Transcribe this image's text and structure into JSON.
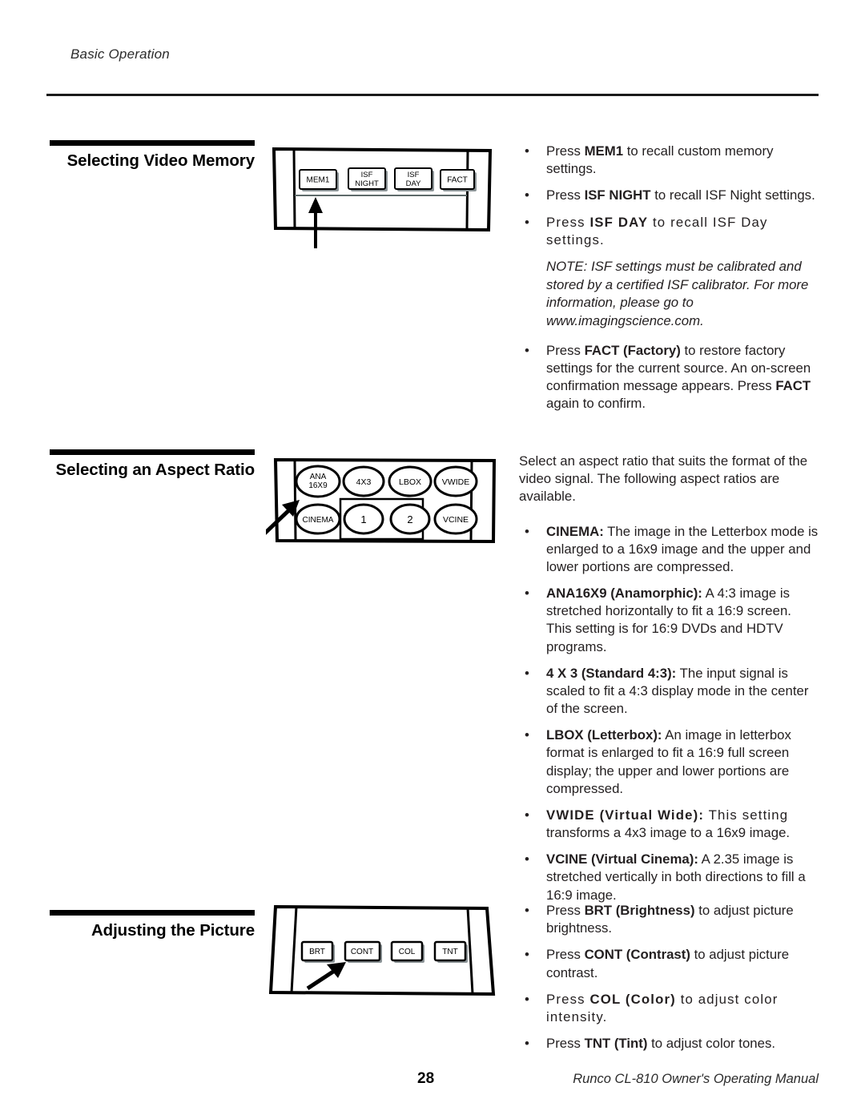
{
  "header": {
    "running_head": "Basic Operation"
  },
  "sections": [
    {
      "id": "video-memory",
      "heading": "Selecting Video Memory",
      "remote": {
        "name": "video-memory-remote",
        "style": "rect-buttons",
        "buttons": [
          {
            "label_lines": [
              "MEM1"
            ]
          },
          {
            "label_lines": [
              "ISF",
              "NIGHT"
            ]
          },
          {
            "label_lines": [
              "ISF",
              "DAY"
            ]
          },
          {
            "label_lines": [
              "FACT"
            ]
          }
        ],
        "callout": "vertical-arrow-up"
      }
    },
    {
      "id": "aspect-ratio",
      "heading": "Selecting an Aspect Ratio",
      "remote": {
        "name": "aspect-ratio-remote",
        "style": "oval-buttons",
        "row1": [
          {
            "label_lines": [
              "ANA",
              "16X9"
            ]
          },
          {
            "label_lines": [
              "4X3"
            ]
          },
          {
            "label_lines": [
              "LBOX"
            ]
          },
          {
            "label_lines": [
              "VWIDE"
            ]
          }
        ],
        "row2": [
          {
            "label_lines": [
              "CINEMA"
            ]
          },
          {
            "label_lines": [
              "1"
            ]
          },
          {
            "label_lines": [
              "2"
            ]
          },
          {
            "label_lines": [
              "VCINE"
            ]
          }
        ],
        "callout": "diagonal-arrow-up-right"
      }
    },
    {
      "id": "adjusting-picture",
      "heading": "Adjusting the Picture",
      "remote": {
        "name": "picture-adjust-remote",
        "style": "rect-buttons",
        "buttons": [
          {
            "label_lines": [
              "BRT"
            ]
          },
          {
            "label_lines": [
              "CONT"
            ]
          },
          {
            "label_lines": [
              "COL"
            ]
          },
          {
            "label_lines": [
              "TNT"
            ]
          }
        ],
        "callout": "diagonal-arrow-up-right"
      }
    }
  ],
  "body": {
    "video_memory": {
      "bullets": [
        {
          "prefix": "Press ",
          "bold": "MEM1",
          "rest": " to recall custom memory settings."
        },
        {
          "prefix": "Press ",
          "bold": "ISF NIGHT",
          "rest": " to recall ISF Night settings."
        },
        {
          "prefix": "Press ",
          "bold": "ISF DAY",
          "rest": " to recall ISF Day settings.",
          "tracking": "wide"
        }
      ],
      "note": "NOTE: ISF settings must be calibrated and stored by a certified ISF calibrator. For more information, please go to www.imagingscience.com.",
      "bullets_after": [
        {
          "prefix": "Press ",
          "bold": "FACT (Factory)",
          "rest": " to restore factory settings for the current source. An on-screen confirmation message appears. Press ",
          "bold2": "FACT",
          "rest2": " again to confirm."
        }
      ]
    },
    "aspect_ratio": {
      "intro": "Select an aspect ratio that suits the format of the video signal. The following aspect ratios are available.",
      "bullets": [
        {
          "bold": "CINEMA:",
          "rest": " The image in the Letterbox mode is enlarged to a 16x9 image and the upper and lower portions are compressed."
        },
        {
          "bold": "ANA16X9 (Anamorphic):",
          "rest": " A 4:3 image is stretched horizontally to fit a 16:9 screen. This setting is for 16:9 DVDs and HDTV programs."
        },
        {
          "bold": "4 X 3 (Standard 4:3):",
          "rest": " The input signal is scaled to fit a 4:3 display mode in the center of the screen."
        },
        {
          "bold": "LBOX (Letterbox):",
          "rest": " An image in letterbox format is enlarged to fit a 16:9 full screen display; the upper and lower portions are compressed."
        },
        {
          "bold": "VWIDE (Virtual Wide):",
          "rest": " This setting transforms a 4x3 image to a 16x9 image.",
          "tracking": "wide"
        },
        {
          "bold": "VCINE (Virtual Cinema):",
          "rest": " A 2.35 image is stretched vertically in both directions to fill a 16:9 image."
        }
      ]
    },
    "adjusting_picture": {
      "bullets": [
        {
          "prefix": "Press ",
          "bold": "BRT (Brightness)",
          "rest": " to adjust picture brightness."
        },
        {
          "prefix": "Press ",
          "bold": "CONT (Contrast)",
          "rest": " to adjust picture contrast."
        },
        {
          "prefix": "Press ",
          "bold": "COL (Color)",
          "rest": " to adjust color intensity.",
          "tracking": "wide"
        },
        {
          "prefix": "Press ",
          "bold": "TNT (Tint)",
          "rest": " to adjust color tones."
        }
      ]
    }
  },
  "footer": {
    "page_number": "28",
    "manual_title": "Runco CL-810 Owner's Operating Manual"
  }
}
